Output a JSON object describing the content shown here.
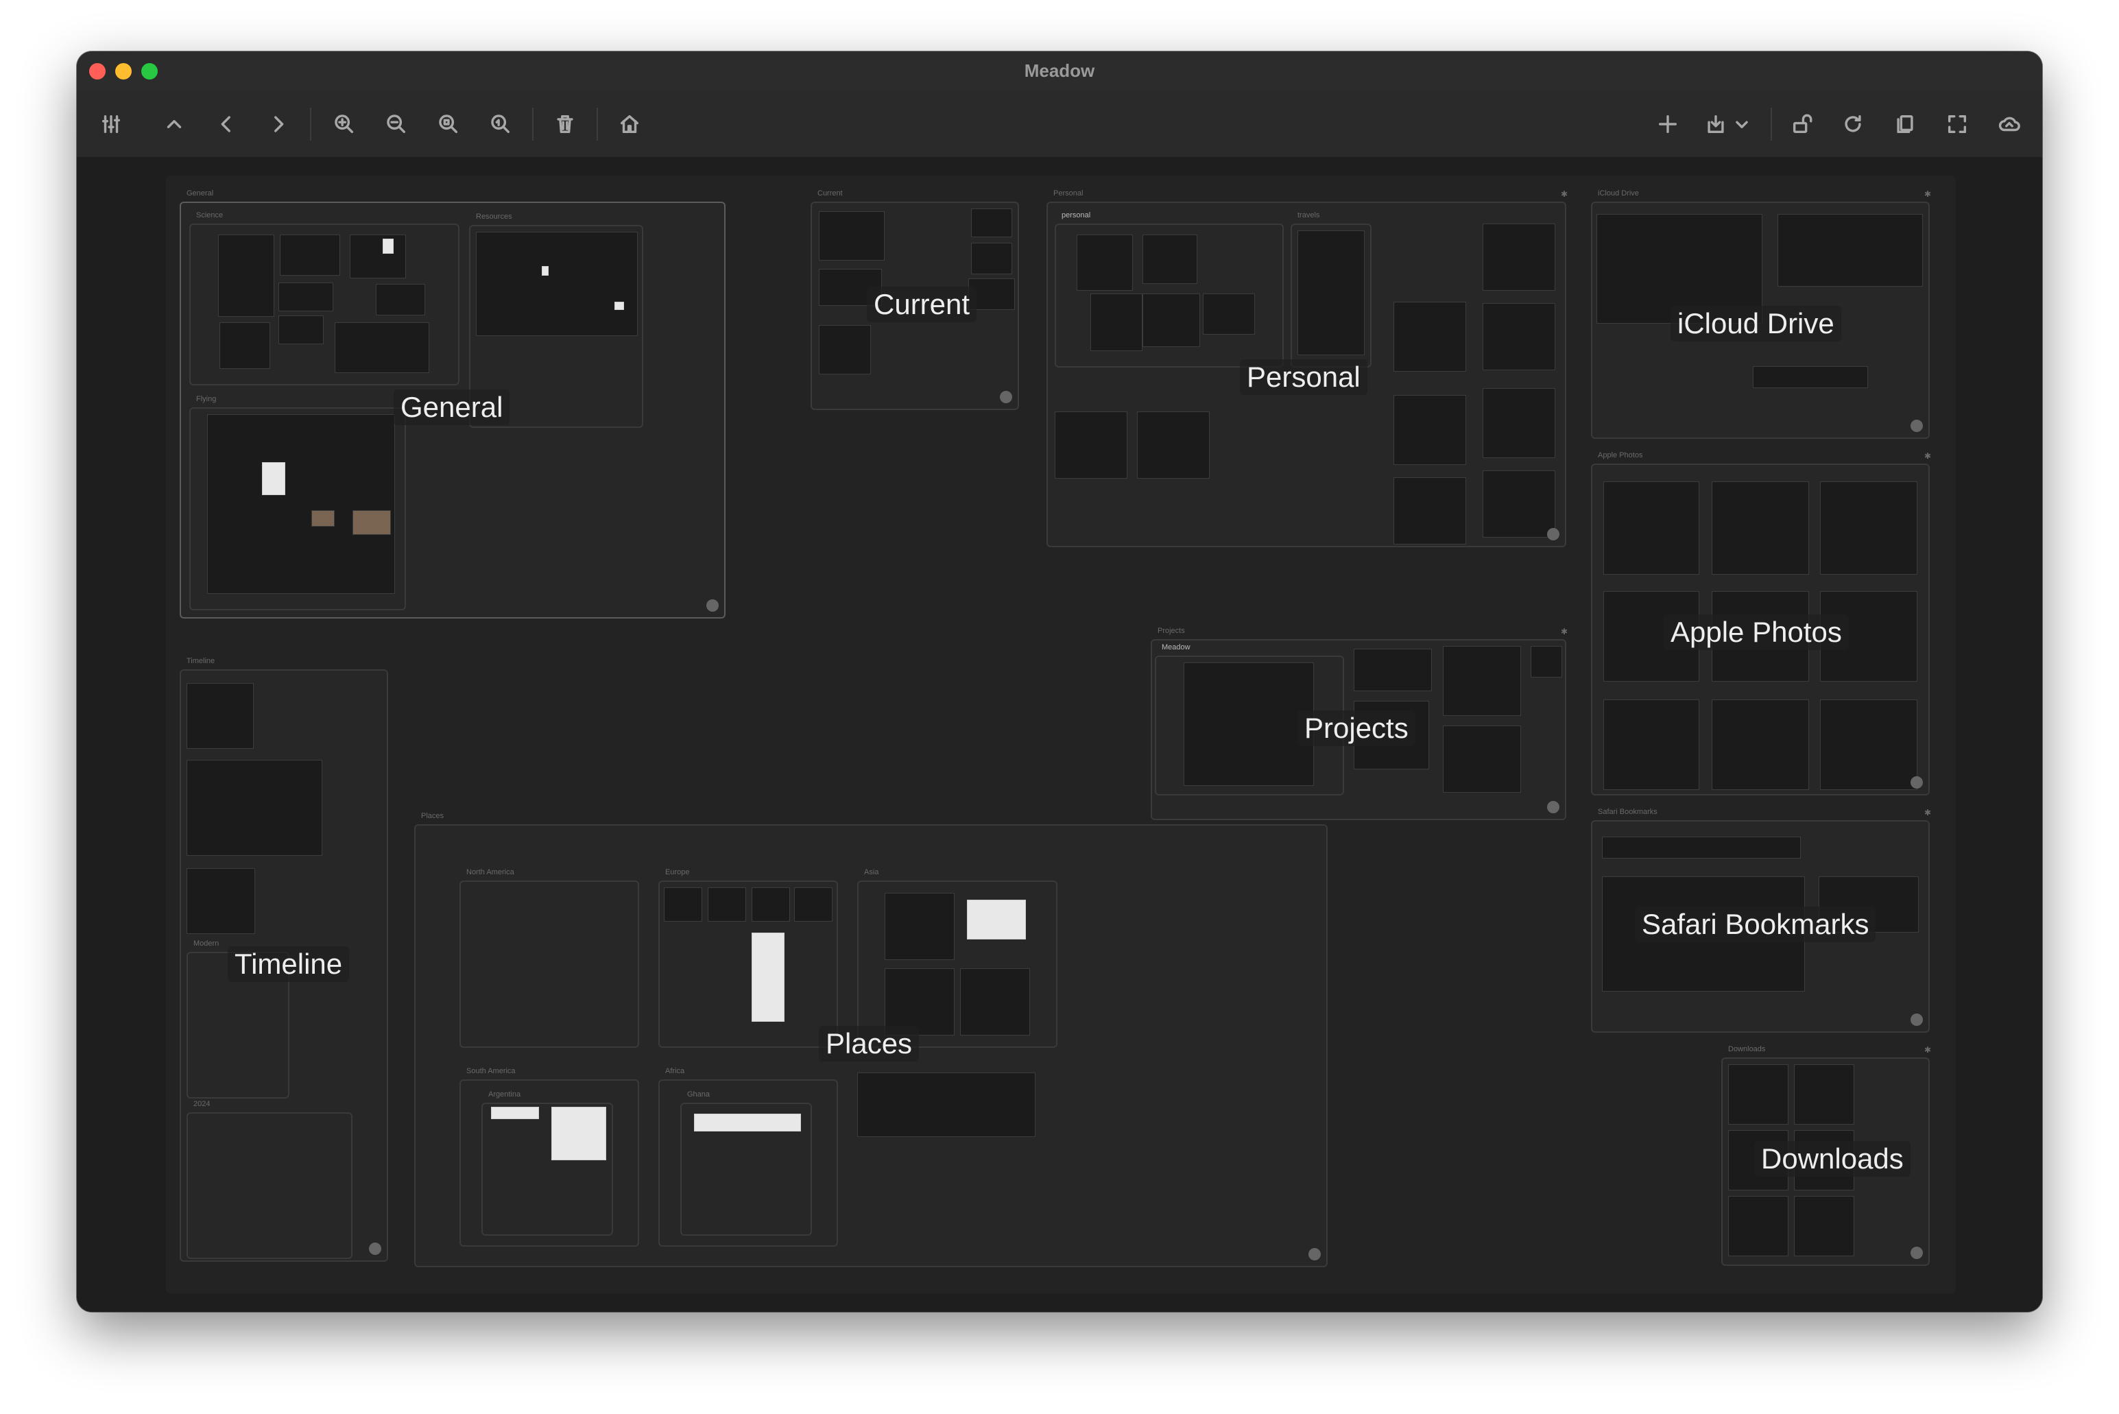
{
  "window": {
    "title": "Meadow"
  },
  "traffic_lights": {
    "close": "#ff5f57",
    "minimize": "#febc2e",
    "zoom": "#28c840"
  },
  "toolbar": {
    "left_icons": [
      "sliders-icon",
      "chevron-up-icon",
      "chevron-left-icon",
      "chevron-right-icon",
      "zoom-in-icon",
      "zoom-out-icon",
      "zoom-fit-icon",
      "zoom-actual-icon",
      "trash-icon",
      "home-icon"
    ],
    "right_icons": [
      "plus-icon",
      "import-icon",
      "unlock-icon",
      "refresh-icon",
      "copy-icon",
      "fullscreen-icon",
      "cloud-icon"
    ]
  },
  "groups": {
    "general": {
      "label": "General",
      "caption": "General",
      "sub": {
        "science": "Science",
        "resources": "Resources",
        "flying": "Flying"
      }
    },
    "current": {
      "label": "Current",
      "caption": "Current"
    },
    "personal": {
      "label": "Personal",
      "caption": "Personal",
      "sub": {
        "personal": "personal",
        "travels": "travels"
      }
    },
    "projects": {
      "label": "Projects",
      "caption": "Projects",
      "sub": {
        "meadow": "Meadow"
      }
    },
    "icloud": {
      "label": "iCloud Drive",
      "caption": "iCloud Drive"
    },
    "photos": {
      "label": "Apple Photos",
      "caption": "Apple Photos"
    },
    "safari": {
      "label": "Safari Bookmarks",
      "caption": "Safari Bookmarks"
    },
    "downloads": {
      "label": "Downloads",
      "caption": "Downloads"
    },
    "timeline": {
      "label": "Timeline",
      "caption": "Timeline",
      "sub": {
        "modern": "Modern",
        "y2024": "2024"
      }
    },
    "places": {
      "label": "Places",
      "caption": "Places",
      "sub": {
        "north_america": "North America",
        "europe": "Europe",
        "asia": "Asia",
        "south_america": "South America",
        "argentina": "Argentina",
        "africa": "Africa",
        "ghana": "Ghana"
      }
    }
  }
}
